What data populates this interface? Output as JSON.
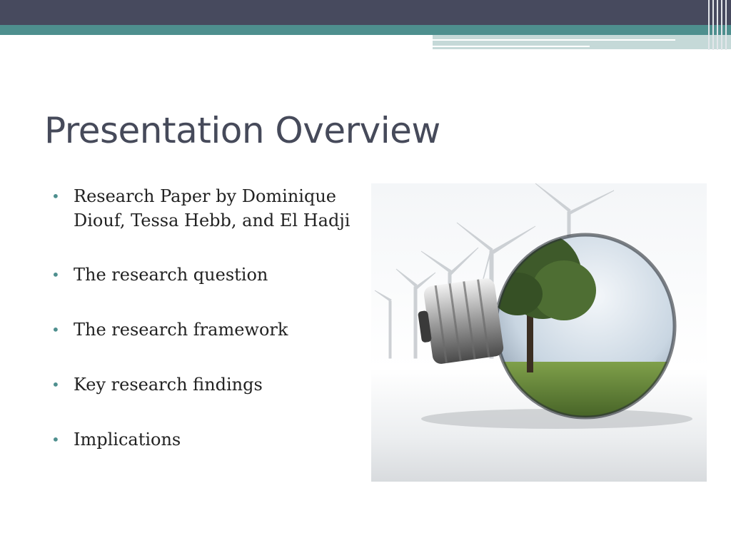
{
  "slide": {
    "title": "Presentation Overview",
    "bullets": [
      "Research Paper by Dominique Diouf, Tessa Hebb, and El Hadji",
      "The research question",
      "The research framework",
      "Key research findings",
      "Implications"
    ],
    "bullet_glyph": "•"
  },
  "image": {
    "icon": "light-bulb-landscape-icon"
  },
  "theme": {
    "dark": "#474a5e",
    "teal": "#4e8f8e",
    "light": "#c5d9d8"
  }
}
